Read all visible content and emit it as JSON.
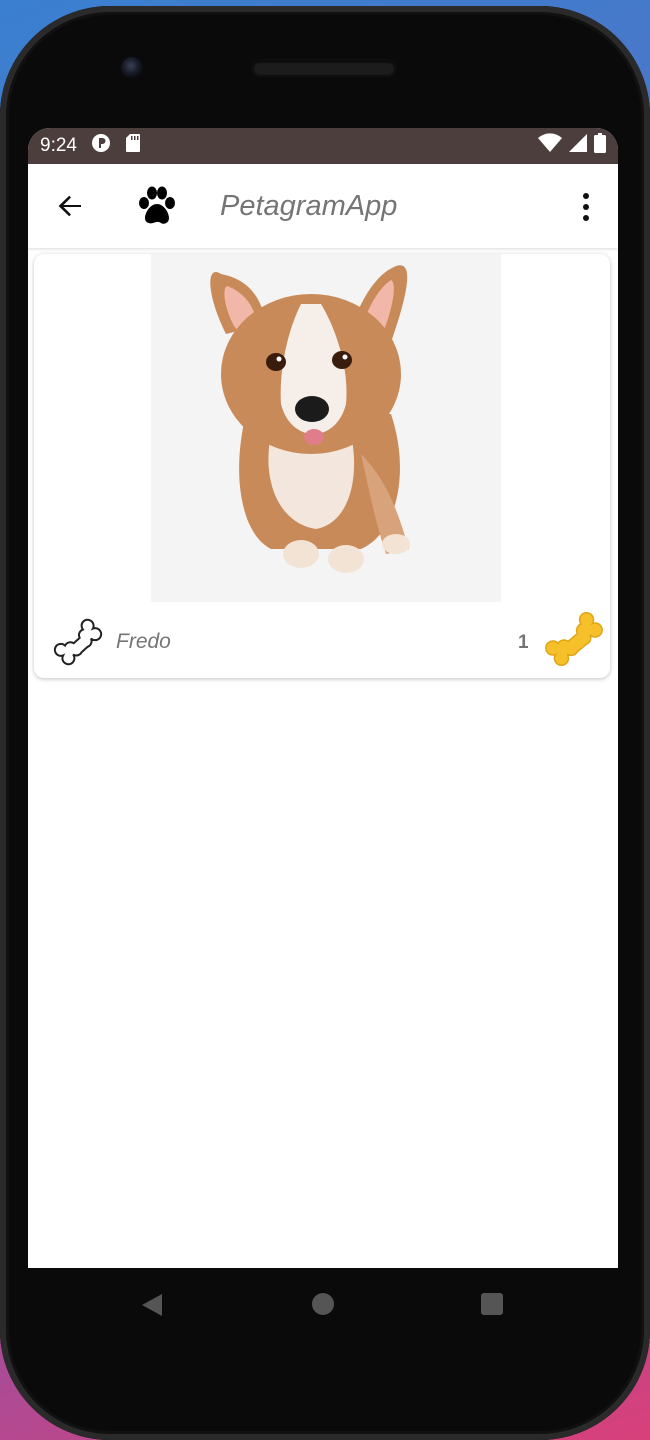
{
  "status_bar": {
    "time": "9:24",
    "icons": [
      "p-circle-icon",
      "sd-card-icon",
      "wifi-icon",
      "signal-icon",
      "battery-icon"
    ]
  },
  "app_bar": {
    "title": "PetagramApp",
    "icons": [
      "back-arrow-icon",
      "paw-icon",
      "overflow-menu-icon"
    ]
  },
  "pet_card": {
    "name": "Fredo",
    "likes": "1",
    "icons": [
      "bone-outline-icon",
      "bone-gold-icon"
    ]
  },
  "nav_bar": {
    "icons": [
      "nav-back-icon",
      "nav-home-icon",
      "nav-recents-icon"
    ]
  },
  "colors": {
    "status_bar": "#4d3e3e",
    "title_text": "#757575",
    "bone_gold": "#f5c02a"
  }
}
